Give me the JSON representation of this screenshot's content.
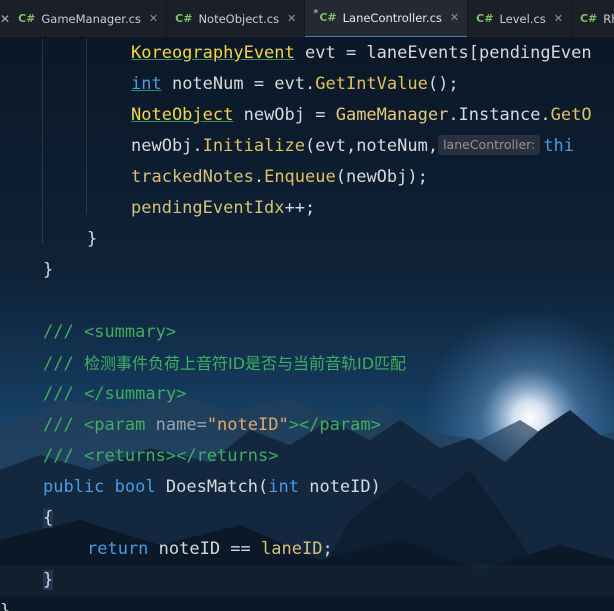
{
  "tabs": [
    {
      "label": "GameManager.cs",
      "active": false,
      "modified": false
    },
    {
      "label": "NoteObject.cs",
      "active": false,
      "modified": false
    },
    {
      "label": "LaneController.cs",
      "active": true,
      "modified": true
    },
    {
      "label": "Level.cs",
      "active": false,
      "modified": false
    },
    {
      "label": "RhythmGameM",
      "active": false,
      "modified": false
    }
  ],
  "tab_lang_badge": "C#",
  "code": {
    "l1": {
      "type": "KoreographyEvent",
      "rest": " evt = laneEvents[pendingEven"
    },
    "l2": {
      "kw": "int",
      "a": " noteNum = evt.",
      "method": "GetIntValue",
      "b": "();"
    },
    "l3": {
      "type": "NoteObject",
      "a": " newObj = ",
      "cls": "GameManager",
      "b": ".Instance.",
      "method": "GetO"
    },
    "l4": {
      "a": "newObj.",
      "method": "Initialize",
      "b": "(evt,noteNum,",
      "hint": "laneController:",
      "this": "thi"
    },
    "l5": {
      "field": "trackedNotes",
      "a": ".",
      "method": "Enqueue",
      "b": "(newObj);"
    },
    "l6": {
      "field": "pendingEventIdx",
      "a": "++;"
    },
    "l7": "}",
    "l8": "}",
    "doc1": {
      "slashes": "///",
      "tag": "<summary>"
    },
    "doc2": {
      "slashes": "///",
      "text": "检测事件负荷上音符ID是否与当前音轨ID匹配"
    },
    "doc3": {
      "slashes": "///",
      "tag": "</summary>"
    },
    "doc4": {
      "slashes": "///",
      "open": "<param",
      "attr": " name=",
      "val": "\"noteID\"",
      "close": "></param>"
    },
    "doc5": {
      "slashes": "///",
      "tag": "<returns></returns>"
    },
    "sig": {
      "kw1": "public",
      "kw2": "bool",
      "name": "DoesMatch",
      "kw3": "int",
      "param": "noteID"
    },
    "brace_open": "{",
    "ret": {
      "kw": "return",
      "a": " noteID == ",
      "field": "laneID",
      "b": ";"
    },
    "brace_close": "}",
    "final_brace": "}"
  },
  "colors": {
    "keyword": "#4b9be3",
    "type": "#f3d54a",
    "comment": "#3fae5e",
    "string": "#e7a566",
    "background": "#0a1a2c"
  }
}
